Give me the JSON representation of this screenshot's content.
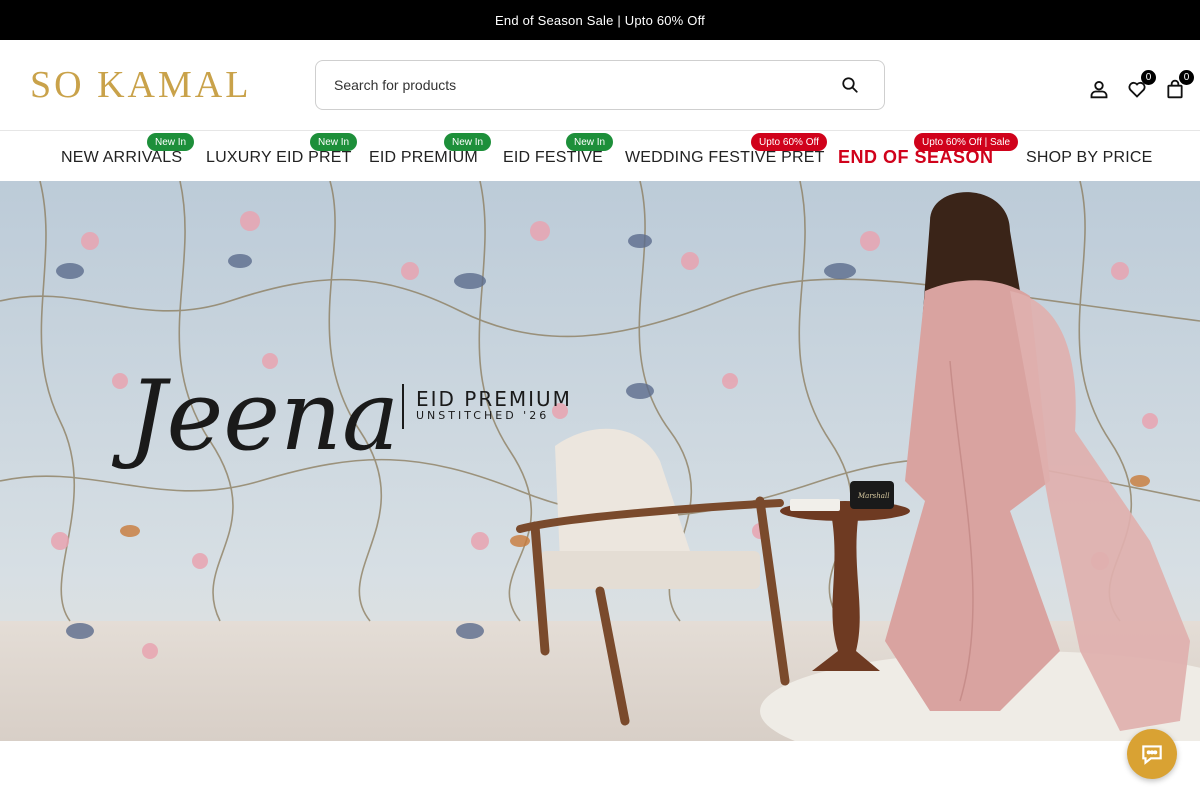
{
  "announcement": {
    "text": "End of Season Sale | Upto 60% Off"
  },
  "brand": {
    "logo_text": "SO KAMAL",
    "color": "#c9a24a"
  },
  "search": {
    "placeholder": "Search for products",
    "value": ""
  },
  "header_icons": {
    "account": {
      "icon": "user-icon"
    },
    "wishlist": {
      "icon": "heart-icon",
      "count": "0"
    },
    "cart": {
      "icon": "shopping-bag-icon",
      "count": "0"
    }
  },
  "nav": {
    "items": [
      {
        "label": "NEW ARRIVALS",
        "badge": "New In",
        "badge_color": "#1d8f3a"
      },
      {
        "label": "LUXURY EID PRET",
        "badge": "New In",
        "badge_color": "#1d8f3a"
      },
      {
        "label": "EID PREMIUM",
        "badge": "New In",
        "badge_color": "#1d8f3a"
      },
      {
        "label": "EID FESTIVE",
        "badge": "New In",
        "badge_color": "#1d8f3a"
      },
      {
        "label": "WEDDING FESTIVE PRET",
        "badge": "Upto 60% Off",
        "badge_color": "#d0021b"
      },
      {
        "label": "END OF SEASON",
        "badge": "Upto 60% Off | Sale",
        "badge_color": "#d0021b",
        "accent": "#d0021b"
      },
      {
        "label": "SHOP BY PRICE",
        "badge": ""
      }
    ]
  },
  "hero": {
    "script_title": "Jeena",
    "headline": "EID PREMIUM",
    "subline": "UNSTITCHED '26",
    "speaker_brand": "Marshall"
  },
  "chat": {
    "icon": "chat-bubble-icon",
    "color": "#d9a233"
  }
}
